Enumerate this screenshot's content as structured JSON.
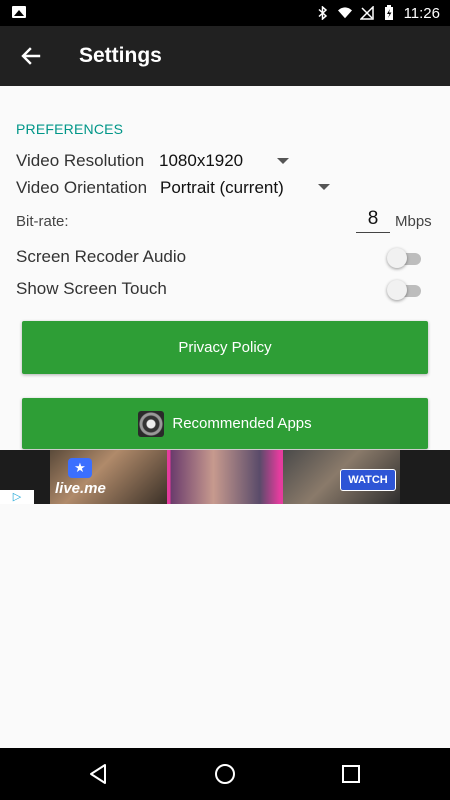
{
  "status_bar": {
    "time": "11:26",
    "icons": [
      "image-icon",
      "bluetooth-icon",
      "wifi-icon",
      "no-sim-icon",
      "battery-charging-icon",
      "signal-icon"
    ]
  },
  "toolbar": {
    "title": "Settings",
    "back_icon": "arrow-left"
  },
  "preferences": {
    "header": "PREFERENCES",
    "video_resolution": {
      "label": "Video Resolution",
      "value": "1080x1920"
    },
    "video_orientation": {
      "label": "Video Orientation",
      "value": "Portrait (current)"
    },
    "bitrate": {
      "label": "Bit-rate:",
      "value": "8",
      "unit": "Mbps"
    },
    "audio": {
      "label": "Screen Recoder Audio",
      "enabled": false
    },
    "touch": {
      "label": "Show Screen Touch",
      "enabled": false
    }
  },
  "buttons": {
    "privacy_policy": "Privacy Policy",
    "recommended_apps": "Recommended Apps"
  },
  "ad": {
    "brand": "live.me",
    "cta": "WATCH",
    "choices": "▷"
  },
  "nav_bar": {
    "icons": [
      "back-triangle",
      "home-circle",
      "recents-square"
    ]
  },
  "colors": {
    "accent": "#009688",
    "button": "#2e9e36",
    "toolbar": "#212121"
  }
}
